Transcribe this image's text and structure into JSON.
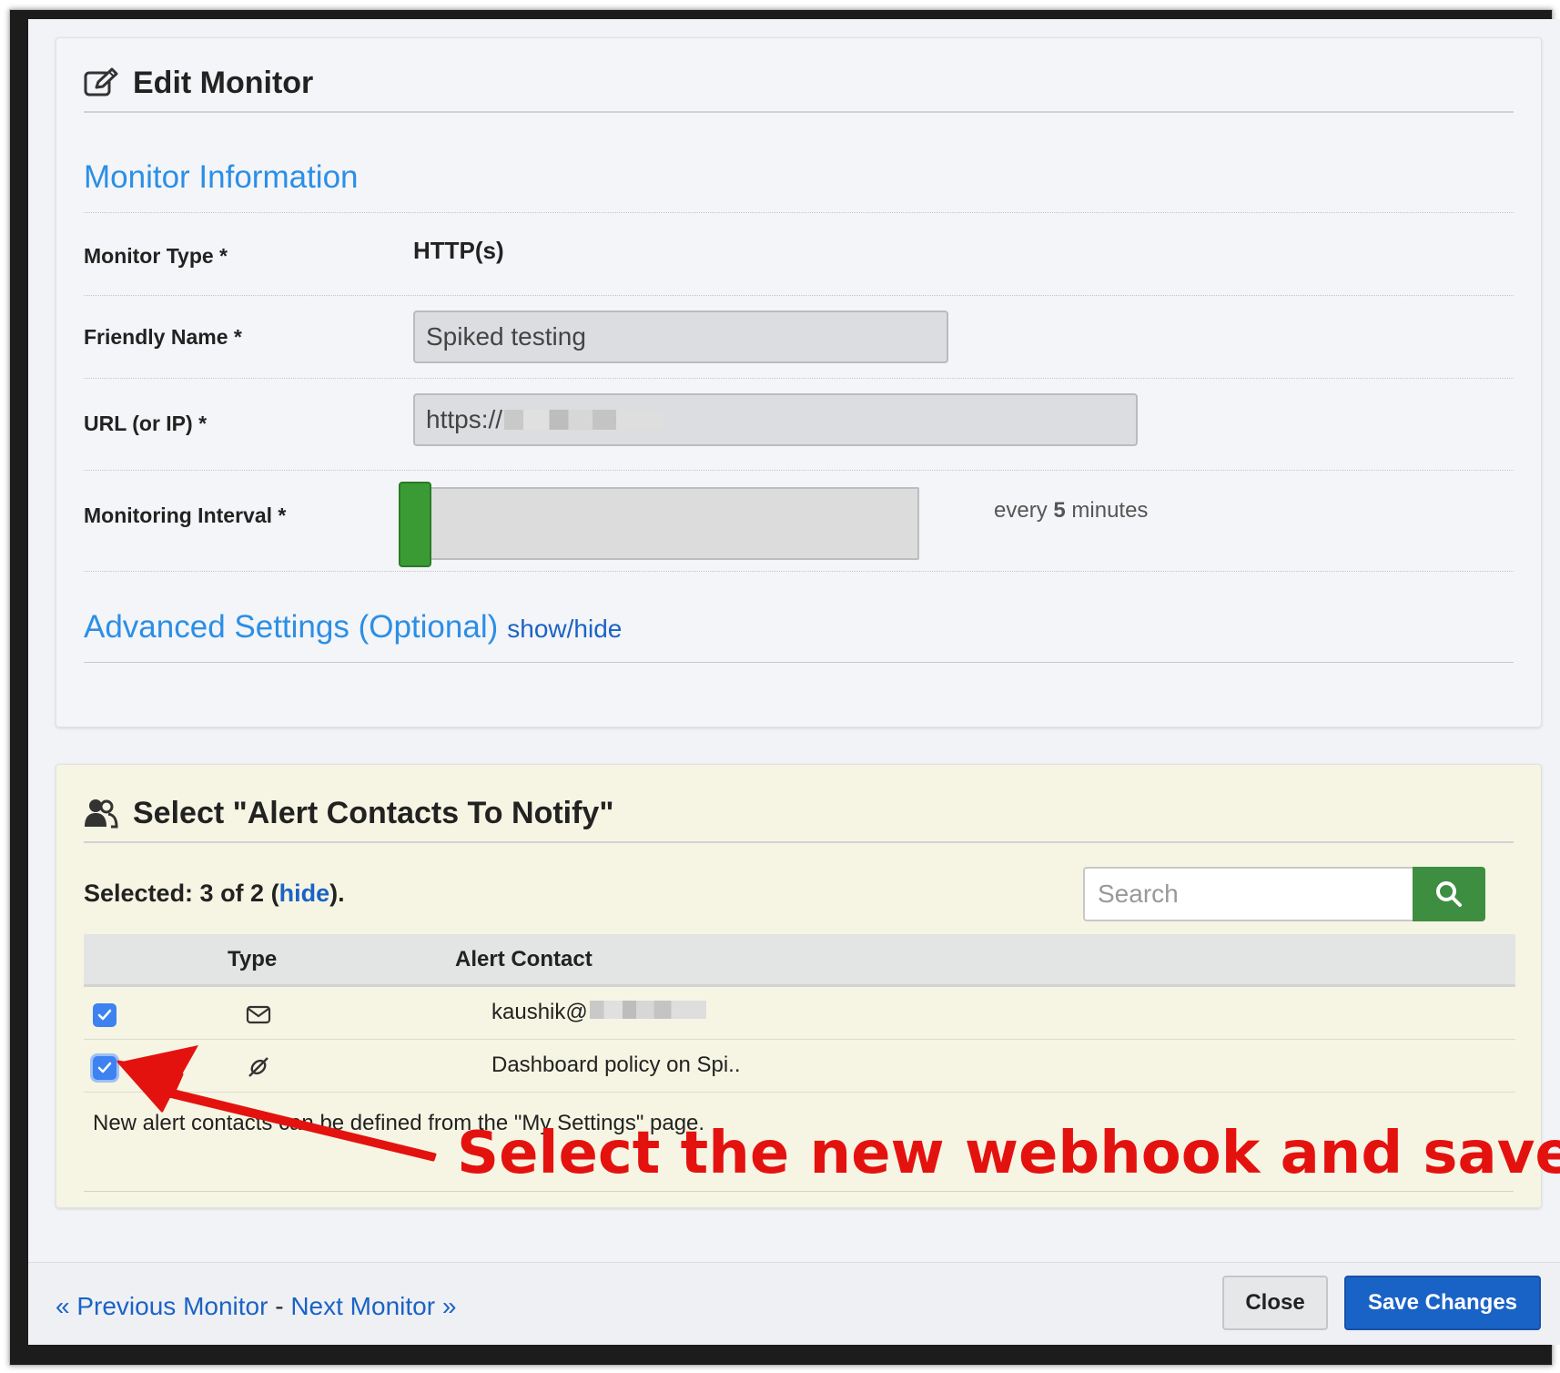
{
  "edit_panel": {
    "title": "Edit Monitor",
    "title_icon": "edit-icon",
    "section_title": "Monitor Information",
    "fields": {
      "monitor_type_label": "Monitor Type *",
      "monitor_type_value": "HTTP(s)",
      "friendly_name_label": "Friendly Name *",
      "friendly_name_value": "Spiked testing",
      "url_label": "URL (or IP) *",
      "url_value": "https://",
      "interval_label": "Monitoring Interval *",
      "interval_prefix": "every",
      "interval_value": "5",
      "interval_suffix": "minutes"
    },
    "advanced_title": "Advanced Settings (Optional)",
    "advanced_toggle": "show/hide"
  },
  "alert_panel": {
    "title": "Select \"Alert Contacts To Notify\"",
    "title_icon": "users-icon",
    "selected_prefix": "Selected: 3 of 2 (",
    "selected_link": "hide",
    "selected_suffix": ").",
    "search_placeholder": "Search",
    "search_icon": "search-icon",
    "columns": [
      "Type",
      "Alert Contact"
    ],
    "rows": [
      {
        "checked": true,
        "type_icon": "envelope-icon",
        "contact": "kaushik@"
      },
      {
        "checked": true,
        "type_icon": "webhook-icon",
        "contact": "Dashboard policy on Spi.."
      }
    ],
    "note": "New alert contacts can be defined from the \"My Settings\" page."
  },
  "footer": {
    "prev": "« Previous Monitor",
    "separator": " - ",
    "next": "Next Monitor »",
    "close_label": "Close",
    "save_label": "Save Changes"
  },
  "annotation": {
    "text": "Select the new webhook and save",
    "color": "#e4120f"
  },
  "colors": {
    "accent_blue": "#2b8fe6",
    "link_blue": "#1a63c6",
    "slider_green": "#3a9b35",
    "search_green": "#3e8e41"
  }
}
